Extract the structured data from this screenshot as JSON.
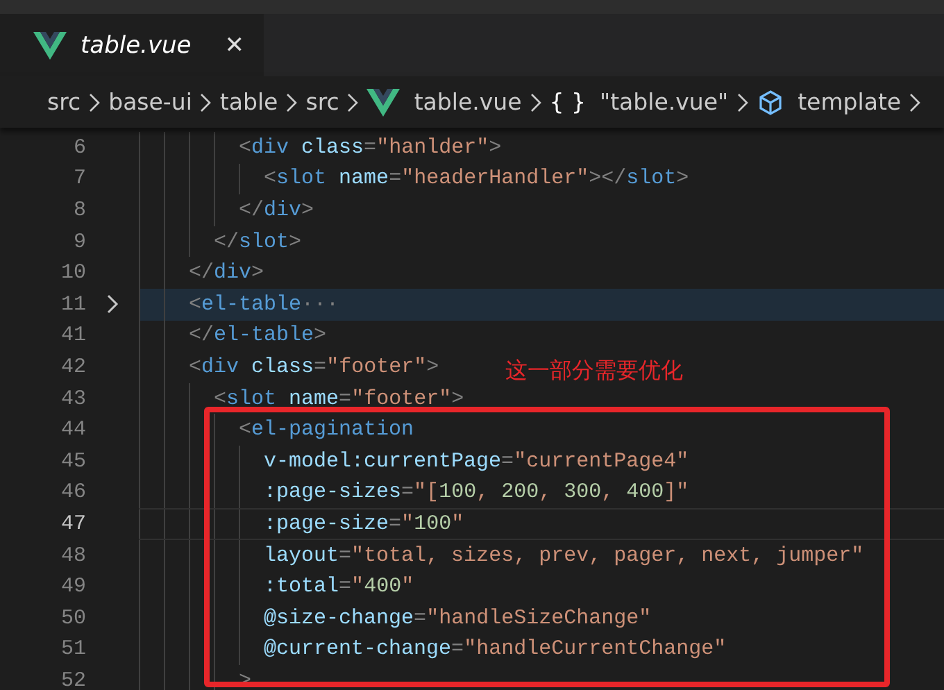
{
  "tabs": [
    {
      "label": "table.vue",
      "selected": true,
      "close": "✕"
    }
  ],
  "breadcrumb": [
    {
      "kind": "folder",
      "label": "src"
    },
    {
      "kind": "folder",
      "label": "base-ui"
    },
    {
      "kind": "folder",
      "label": "table"
    },
    {
      "kind": "folder",
      "label": "src"
    },
    {
      "kind": "vue-file",
      "label": "table.vue"
    },
    {
      "kind": "object",
      "symbol": "{ }",
      "label": "\"table.vue\""
    },
    {
      "kind": "element",
      "label": "template"
    }
  ],
  "editor": {
    "lines": [
      {
        "number": "6",
        "folded": false,
        "current": false,
        "tokens": [
          {
            "kind": "punct",
            "text": "        <"
          },
          {
            "kind": "tag",
            "text": "div"
          },
          {
            "kind": "attr",
            "text": " class"
          },
          {
            "kind": "punct",
            "text": "="
          },
          {
            "kind": "string",
            "text": "\"hanlder\""
          },
          {
            "kind": "punct",
            "text": ">"
          }
        ]
      },
      {
        "number": "7",
        "folded": false,
        "current": false,
        "tokens": [
          {
            "kind": "punct",
            "text": "          <"
          },
          {
            "kind": "tag",
            "text": "slot"
          },
          {
            "kind": "attr",
            "text": " name"
          },
          {
            "kind": "punct",
            "text": "="
          },
          {
            "kind": "string",
            "text": "\"headerHandler\""
          },
          {
            "kind": "punct",
            "text": "></"
          },
          {
            "kind": "tag",
            "text": "slot"
          },
          {
            "kind": "punct",
            "text": ">"
          }
        ]
      },
      {
        "number": "8",
        "folded": false,
        "current": false,
        "tokens": [
          {
            "kind": "punct",
            "text": "        </"
          },
          {
            "kind": "tag",
            "text": "div"
          },
          {
            "kind": "punct",
            "text": ">"
          }
        ]
      },
      {
        "number": "9",
        "folded": false,
        "current": false,
        "tokens": [
          {
            "kind": "punct",
            "text": "      </"
          },
          {
            "kind": "tag",
            "text": "slot"
          },
          {
            "kind": "punct",
            "text": ">"
          }
        ]
      },
      {
        "number": "10",
        "folded": false,
        "current": false,
        "tokens": [
          {
            "kind": "punct",
            "text": "    </"
          },
          {
            "kind": "tag",
            "text": "div"
          },
          {
            "kind": "punct",
            "text": ">"
          }
        ]
      },
      {
        "number": "11",
        "folded": true,
        "current": false,
        "tokens": [
          {
            "kind": "punct",
            "text": "    <"
          },
          {
            "kind": "tag",
            "text": "el-table"
          },
          {
            "kind": "punct",
            "text": "···"
          }
        ]
      },
      {
        "number": "41",
        "folded": false,
        "current": false,
        "tokens": [
          {
            "kind": "punct",
            "text": "    </"
          },
          {
            "kind": "tag",
            "text": "el-table"
          },
          {
            "kind": "punct",
            "text": ">"
          }
        ]
      },
      {
        "number": "42",
        "folded": false,
        "current": false,
        "tokens": [
          {
            "kind": "punct",
            "text": "    <"
          },
          {
            "kind": "tag",
            "text": "div"
          },
          {
            "kind": "attr",
            "text": " class"
          },
          {
            "kind": "punct",
            "text": "="
          },
          {
            "kind": "string",
            "text": "\"footer\""
          },
          {
            "kind": "punct",
            "text": ">"
          }
        ]
      },
      {
        "number": "43",
        "folded": false,
        "current": false,
        "tokens": [
          {
            "kind": "punct",
            "text": "      <"
          },
          {
            "kind": "tag",
            "text": "slot"
          },
          {
            "kind": "attr",
            "text": " name"
          },
          {
            "kind": "punct",
            "text": "="
          },
          {
            "kind": "string",
            "text": "\"footer\""
          },
          {
            "kind": "punct",
            "text": ">"
          }
        ]
      },
      {
        "number": "44",
        "folded": false,
        "current": false,
        "tokens": [
          {
            "kind": "punct",
            "text": "        <"
          },
          {
            "kind": "tag",
            "text": "el-pagination"
          }
        ]
      },
      {
        "number": "45",
        "folded": false,
        "current": false,
        "tokens": [
          {
            "kind": "attr",
            "text": "          v-model:currentPage"
          },
          {
            "kind": "punct",
            "text": "="
          },
          {
            "kind": "string",
            "text": "\"currentPage4\""
          }
        ]
      },
      {
        "number": "46",
        "folded": false,
        "current": false,
        "tokens": [
          {
            "kind": "attr",
            "text": "          :page-sizes"
          },
          {
            "kind": "punct",
            "text": "="
          },
          {
            "kind": "string",
            "text": "\"["
          },
          {
            "kind": "number",
            "text": "100"
          },
          {
            "kind": "string",
            "text": ", "
          },
          {
            "kind": "number",
            "text": "200"
          },
          {
            "kind": "string",
            "text": ", "
          },
          {
            "kind": "number",
            "text": "300"
          },
          {
            "kind": "string",
            "text": ", "
          },
          {
            "kind": "number",
            "text": "400"
          },
          {
            "kind": "string",
            "text": "]\""
          }
        ]
      },
      {
        "number": "47",
        "folded": false,
        "current": true,
        "tokens": [
          {
            "kind": "attr",
            "text": "          :page-size"
          },
          {
            "kind": "punct",
            "text": "="
          },
          {
            "kind": "string",
            "text": "\""
          },
          {
            "kind": "number",
            "text": "100"
          },
          {
            "kind": "string",
            "text": "\""
          }
        ]
      },
      {
        "number": "48",
        "folded": false,
        "current": false,
        "tokens": [
          {
            "kind": "attr",
            "text": "          layout"
          },
          {
            "kind": "punct",
            "text": "="
          },
          {
            "kind": "string",
            "text": "\"total, sizes, prev, pager, next, jumper\""
          }
        ]
      },
      {
        "number": "49",
        "folded": false,
        "current": false,
        "tokens": [
          {
            "kind": "attr",
            "text": "          :total"
          },
          {
            "kind": "punct",
            "text": "="
          },
          {
            "kind": "string",
            "text": "\""
          },
          {
            "kind": "number",
            "text": "400"
          },
          {
            "kind": "string",
            "text": "\""
          }
        ]
      },
      {
        "number": "50",
        "folded": false,
        "current": false,
        "tokens": [
          {
            "kind": "attr",
            "text": "          @size-change"
          },
          {
            "kind": "punct",
            "text": "="
          },
          {
            "kind": "string",
            "text": "\"handleSizeChange\""
          }
        ]
      },
      {
        "number": "51",
        "folded": false,
        "current": false,
        "tokens": [
          {
            "kind": "attr",
            "text": "          @current-change"
          },
          {
            "kind": "punct",
            "text": "="
          },
          {
            "kind": "string",
            "text": "\"handleCurrentChange\""
          }
        ]
      },
      {
        "number": "52",
        "folded": false,
        "current": false,
        "tokens": [
          {
            "kind": "punct",
            "text": "        >"
          }
        ]
      }
    ]
  },
  "annotation": {
    "note": "这一部分需要优化"
  }
}
